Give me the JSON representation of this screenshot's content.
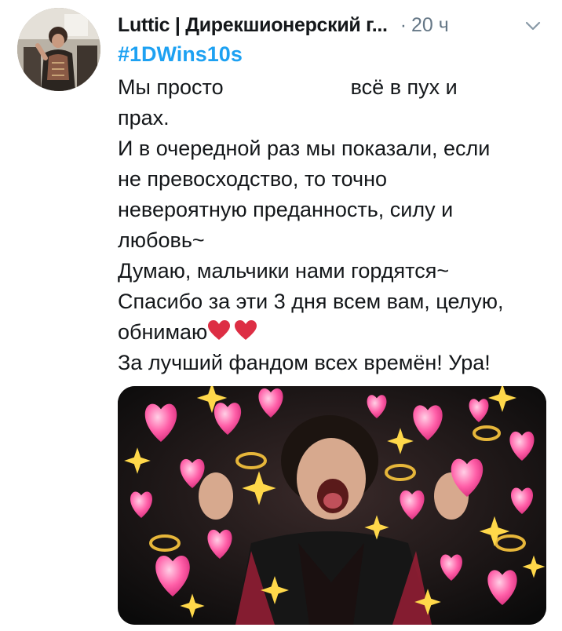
{
  "tweet": {
    "author_name": "Luttic | Дирекшионерский г...",
    "separator": "·",
    "time": "20 ч",
    "hashtag": "#1DWins10s",
    "lines": {
      "l1a": "Мы просто",
      "l1b": "всё в пух и",
      "l2": "прах.",
      "l3": "И в очередной раз мы показали, если",
      "l4": "не превосходство, то точно",
      "l5": "невероятную преданность, силу и",
      "l6": "любовь~",
      "l7": "Думаю, мальчики нами гордятся~",
      "l8": "Спасибо за эти 3 дня всем вам, целую,",
      "l9": "обнимаю",
      "l10": "За лучший фандом всех времён! Ура!"
    },
    "icons": {
      "caret": "chevron-down-icon",
      "emoji": "red-heart-icon"
    },
    "colors": {
      "hashtag": "#1da1f2",
      "meta": "#657786",
      "heart": "#dd2e44"
    }
  }
}
